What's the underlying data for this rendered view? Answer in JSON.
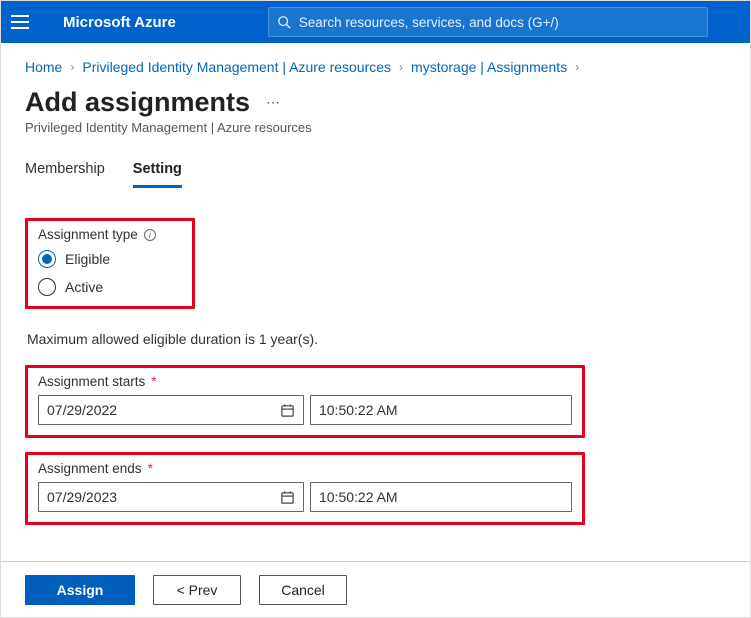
{
  "header": {
    "brand": "Microsoft Azure",
    "search_placeholder": "Search resources, services, and docs (G+/)"
  },
  "breadcrumb": {
    "items": [
      "Home",
      "Privileged Identity Management | Azure resources",
      "mystorage | Assignments"
    ]
  },
  "page": {
    "title": "Add assignments",
    "subtitle": "Privileged Identity Management | Azure resources"
  },
  "tabs": {
    "membership": "Membership",
    "setting": "Setting"
  },
  "assignment_type": {
    "label": "Assignment type",
    "options": {
      "eligible": "Eligible",
      "active": "Active"
    },
    "selected": "eligible"
  },
  "note": "Maximum allowed eligible duration is 1 year(s).",
  "start": {
    "label": "Assignment starts",
    "date": "07/29/2022",
    "time": "10:50:22 AM"
  },
  "end": {
    "label": "Assignment ends",
    "date": "07/29/2023",
    "time": "10:50:22 AM"
  },
  "footer": {
    "assign": "Assign",
    "prev": "<  Prev",
    "cancel": "Cancel"
  }
}
